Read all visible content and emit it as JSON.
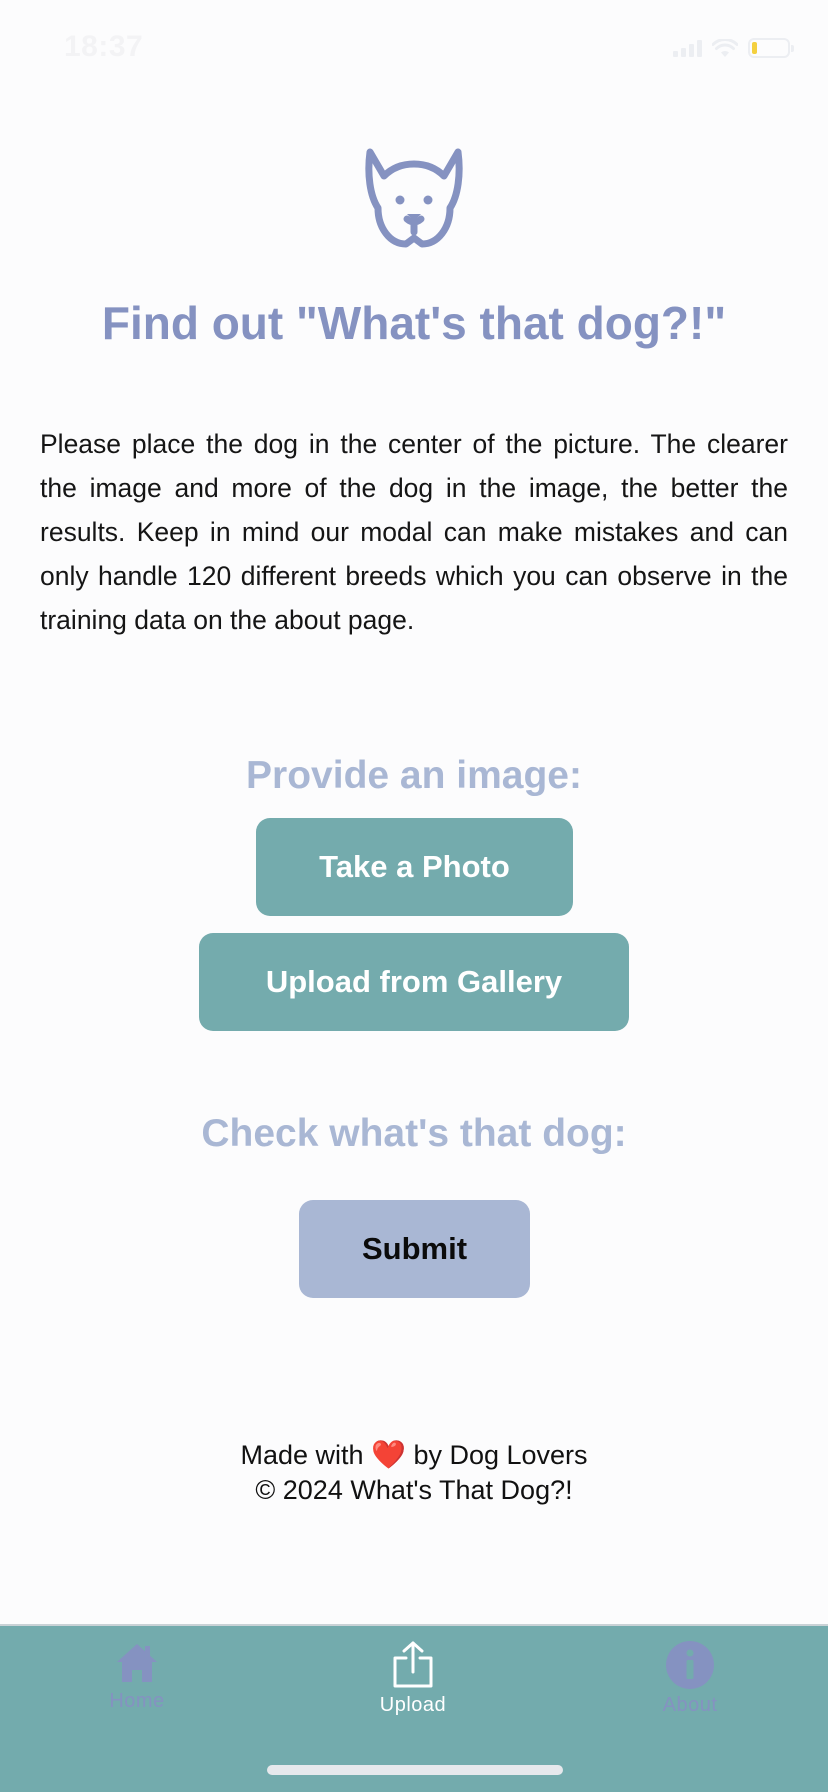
{
  "status_bar": {
    "time": "18:37",
    "battery_color": "#f4d03f"
  },
  "main": {
    "logo_icon": "dog-face-icon",
    "title": "Find out \"What's that dog?!\"",
    "intro": "Please place the dog in the center of the picture. The clearer the image and more of the dog in the image, the better the results. Keep in mind our modal can make mistakes and can only handle 120 different breeds which you can observe in the training data on the about page.",
    "provide_heading": "Provide an image:",
    "take_photo_label": "Take a Photo",
    "upload_gallery_label": "Upload from Gallery",
    "check_heading": "Check what's that dog:",
    "submit_label": "Submit"
  },
  "footer": {
    "made_with": "Made with",
    "heart": "❤️",
    "by": "by Dog Lovers",
    "copyright": "© 2024 What's That Dog?!"
  },
  "tab_bar": {
    "tabs": [
      {
        "label": "Home",
        "icon": "home-icon"
      },
      {
        "label": "Upload",
        "icon": "upload-icon",
        "active": true
      },
      {
        "label": "About",
        "icon": "info-icon"
      }
    ]
  },
  "colors": {
    "accent_purple": "#8592c1",
    "teal_button": "#74abad",
    "submit_button": "#a9b7d4",
    "tab_bar": "#73abad"
  }
}
